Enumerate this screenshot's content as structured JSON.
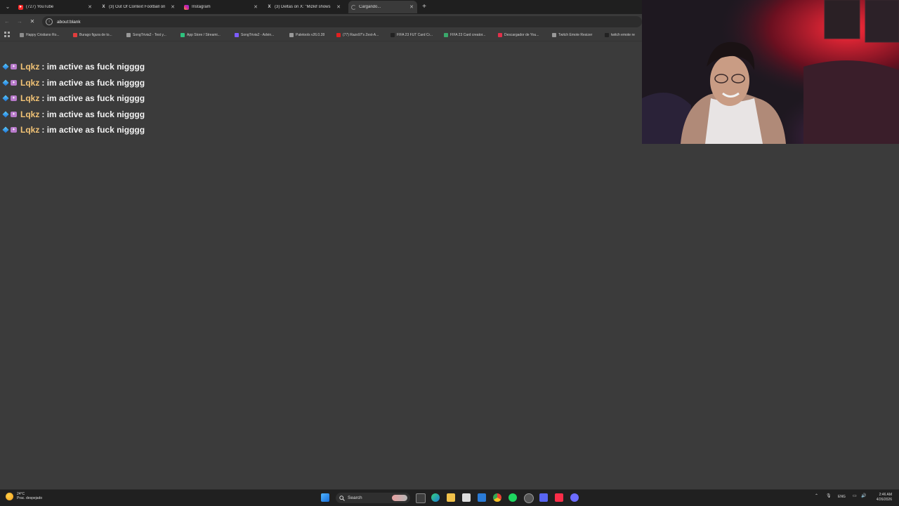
{
  "browser": {
    "tabs": [
      {
        "label": "(727) YouTube",
        "active": false,
        "favicon": "youtube-icon",
        "color": "#ff2a2a"
      },
      {
        "label": "(3) Out Of Context Football on",
        "active": false,
        "favicon": "x-icon",
        "color": "#111111"
      },
      {
        "label": "Instagram",
        "active": false,
        "favicon": "instagram-icon",
        "color": "#d6249f"
      },
      {
        "label": "(3) Deltas on X: \"Mizkif shows",
        "active": false,
        "favicon": "x-icon",
        "color": "#111111"
      },
      {
        "label": "Cargando...",
        "active": true,
        "favicon": "loading-icon",
        "color": "#888888"
      }
    ],
    "address": "about:blank",
    "bookmarks": [
      {
        "label": "Happy Cristiano Ro...",
        "color": "#8c8c8c"
      },
      {
        "label": "Burago figura de to...",
        "color": "#e03d3d"
      },
      {
        "label": "SongTrivia2 - Test y...",
        "color": "#999999"
      },
      {
        "label": "App Store / Streami...",
        "color": "#2ec27e"
      },
      {
        "label": "SongTrivia2 - Advin...",
        "color": "#7d5cff"
      },
      {
        "label": "Paletools v26.0.28",
        "color": "#999999"
      },
      {
        "label": "(77) Razo97's Zest-A...",
        "color": "#e02020"
      },
      {
        "label": "FIFA 23 FUT Card Cr...",
        "color": "#222222"
      },
      {
        "label": "FIFA 23 Card creator...",
        "color": "#3aa86b"
      },
      {
        "label": "Descargador de You...",
        "color": "#e0304a"
      },
      {
        "label": "Twitch Emote Resizer",
        "color": "#999999"
      },
      {
        "label": "twitch emote re",
        "color": "#222222"
      }
    ]
  },
  "chat": {
    "separator": ":",
    "messages": [
      {
        "user": "Lqkz",
        "text": "im active as fuck nigggg"
      },
      {
        "user": "Lqkz",
        "text": "im active as fuck nigggg"
      },
      {
        "user": "Lqkz",
        "text": "im active as fuck nigggg"
      },
      {
        "user": "Lqkz",
        "text": "im active as fuck nigggg"
      },
      {
        "user": "Lqkz",
        "text": "im active as fuck nigggg"
      }
    ]
  },
  "taskbar": {
    "weather_temp": "24°C",
    "weather_desc": "Prac. despejado",
    "search_label": "Search",
    "language": "ENG",
    "time": "2:46 AM",
    "date": "4/26/2026"
  }
}
